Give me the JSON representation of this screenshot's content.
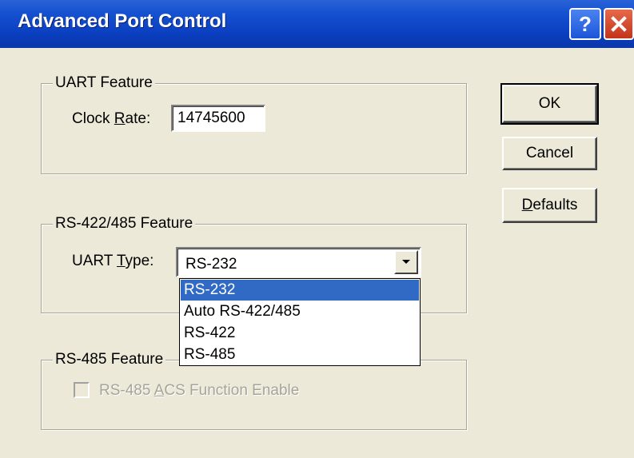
{
  "window": {
    "title": "Advanced Port Control",
    "help_glyph": "?",
    "close_icon": "close-icon"
  },
  "uart_feature": {
    "legend": "UART Feature",
    "clock_rate_label_prefix": "Clock ",
    "clock_rate_label_accel": "R",
    "clock_rate_label_suffix": "ate:",
    "clock_rate_value": "14745600"
  },
  "rs422_feature": {
    "legend": "RS-422/485 Feature",
    "uart_type_label_prefix": "UART ",
    "uart_type_label_accel": "T",
    "uart_type_label_suffix": "ype:",
    "uart_type_value": "RS-232",
    "options": [
      "RS-232",
      "Auto RS-422/485",
      "RS-422",
      "RS-485"
    ],
    "selected_index": 0
  },
  "rs485_feature": {
    "legend": "RS-485 Feature",
    "acs_label_prefix": "RS-485 ",
    "acs_label_accel": "A",
    "acs_label_suffix": "CS Function Enable",
    "acs_checked": false,
    "acs_enabled": false
  },
  "buttons": {
    "ok": "OK",
    "cancel": "Cancel",
    "defaults_accel": "D",
    "defaults_rest": "efaults"
  },
  "colors": {
    "titlebar": "#0a3fc0",
    "face": "#ece9d8",
    "selection": "#316ac5"
  }
}
